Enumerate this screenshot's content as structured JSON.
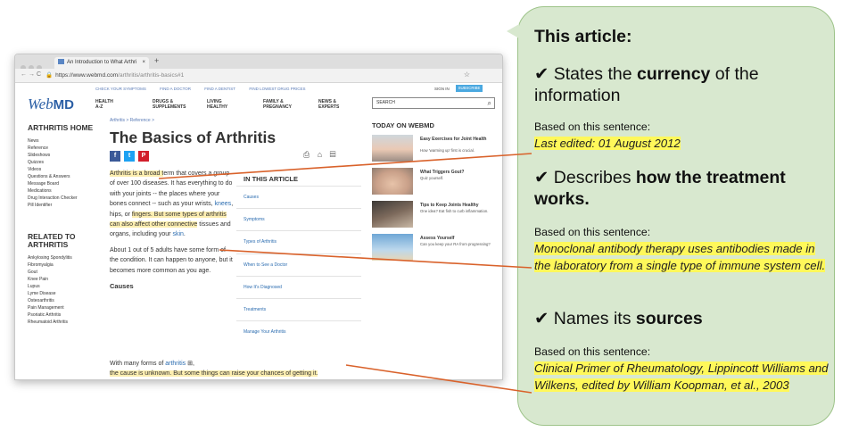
{
  "browser": {
    "tab_title": "An Introduction to What Arthri",
    "tab_close": "×",
    "new_tab": "+",
    "nav_icons": "←→C",
    "url_host": "https://www.webmd.com",
    "url_path": "/arthritis/arthritis-basics#1",
    "star": "☆"
  },
  "site": {
    "topnav": [
      "CHECK YOUR SYMPTOMS",
      "FIND A DOCTOR",
      "FIND A DENTIST",
      "FIND LOWEST DRUG PRICES"
    ],
    "signin": "SIGN IN",
    "subscribe": "SUBSCRIBE",
    "logo_web": "Web",
    "logo_md": "MD",
    "mainnav": [
      {
        "line1": "HEALTH",
        "line2": "A-Z"
      },
      {
        "line1": "DRUGS &",
        "line2": "SUPPLEMENTS"
      },
      {
        "line1": "LIVING",
        "line2": "HEALTHY"
      },
      {
        "line1": "FAMILY &",
        "line2": "PREGNANCY"
      },
      {
        "line1": "NEWS &",
        "line2": "EXPERTS"
      }
    ],
    "search_placeholder": "SEARCH",
    "search_icon": "⌕"
  },
  "leftnav": {
    "home_title": "ARTHRITIS HOME",
    "home_items": [
      "News",
      "Reference",
      "Slideshows",
      "Quizzes",
      "Videos",
      "Questions & Answers",
      "Message Board",
      "Medications",
      "Drug Interaction Checker",
      "Pill Identifier"
    ],
    "related_title": "RELATED TO ARTHRITIS",
    "related_items": [
      "Ankylosing Spondylitis",
      "Fibromyalgia",
      "Gout",
      "Knee Pain",
      "Lupus",
      "Lyme Disease",
      "Osteoarthritis",
      "Pain Management",
      "Psoriatic Arthritis",
      "Rheumatoid Arthritis"
    ]
  },
  "article": {
    "breadcrumb": "Arthritis  >  Reference  >",
    "title": "The Basics of Arthritis",
    "share": {
      "facebook": "f",
      "twitter": "t",
      "pinterest": "P"
    },
    "tools": "⎙ ⌂ ▤",
    "p1_hl1": "Arthritis is a broad t",
    "p1_a": "erm that covers a group of over 100 diseases. It has everything to do with your joints -- the places where your bones connect -- such as your wrists, ",
    "p1_knees": "knees",
    "p1_b": ", hips, or ",
    "p1_hl2": "fingers. But some types of arthritis can also affect other connective",
    "p1_c": " tissues and organs, including your ",
    "p1_skin": "skin",
    "p1_d": ".",
    "p2": "About 1 out of 5 adults have some form of the condition. It can happen to anyone, but it becomes more common as you age.",
    "causes_heading": "Causes",
    "p3_a": "With many forms of ",
    "p3_link": "arthritis",
    "p3_icon": " ⊞,",
    "p3_hl": "the cause is unknown. But some things can raise your chances of getting it."
  },
  "toc": {
    "heading": "IN THIS ARTICLE",
    "items": [
      "Causes",
      "Symptoms",
      "Types of Arthritis",
      "When to See a Doctor",
      "How It's Diagnosed",
      "Treatments",
      "Manage Your Arthritis"
    ]
  },
  "sidebar": {
    "heading": "TODAY ON WEBMD",
    "stories": [
      {
        "title": "Easy Exercises for Joint Health",
        "sub": "How 'warming up' first is crucial."
      },
      {
        "title": "What Triggers Gout?",
        "sub": "Quiz yourself."
      },
      {
        "title": "Tips to Keep Joints Healthy",
        "sub": "One idea? Eat fish to curb inflammation."
      },
      {
        "title": "Assess Yourself",
        "sub": "Can you keep your RA from progressing?"
      }
    ]
  },
  "callout": {
    "title": "This article:",
    "items": [
      {
        "check": "✔",
        "pre": " States the ",
        "bold": "currency",
        "post": " of the information",
        "based": "Based on this sentence:",
        "quote": "Last edited: 01 August 2012"
      },
      {
        "check": "✔",
        "pre": " Describes ",
        "bold": "how the treatment works.",
        "post": "",
        "based": "Based on this sentence:",
        "quote": "Monoclonal antibody therapy uses antibodies made in the laboratory from a single type of immune system cell."
      },
      {
        "check": "✔",
        "pre": " Names its ",
        "bold": "sources",
        "post": "",
        "based": "Based on this sentence:",
        "quote": "Clinical Primer of Rheumatology, Lippincott Williams and Wilkens, edited by William Koopman, et al., 2003"
      }
    ]
  },
  "colors": {
    "bubble": "#d8e8cf",
    "bubble_border": "#9dc389",
    "quote_highlight": "#fff85a",
    "text_highlight": "#fdeeb0",
    "connector": "#d9622b",
    "logo": "#2b5fa5",
    "link": "#2b6cb0"
  }
}
